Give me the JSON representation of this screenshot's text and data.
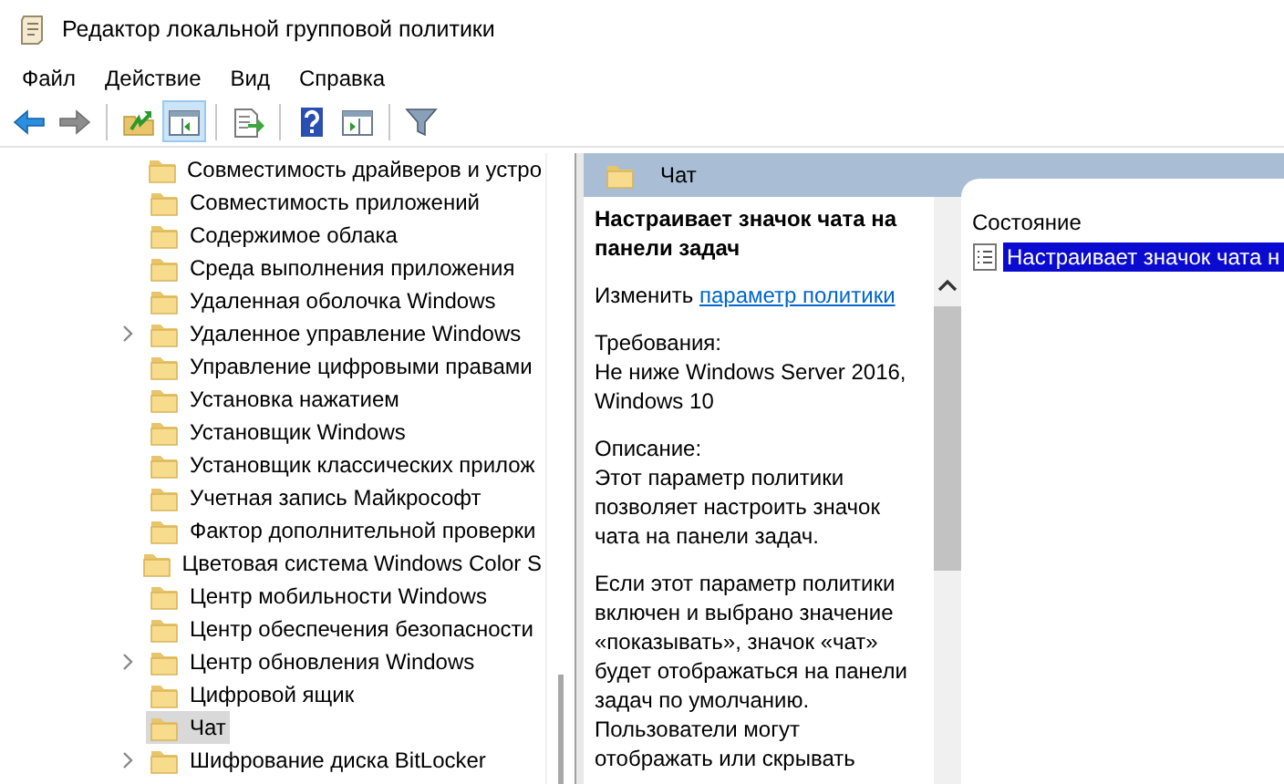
{
  "window": {
    "title": "Редактор локальной групповой политики"
  },
  "menu": [
    "Файл",
    "Действие",
    "Вид",
    "Справка"
  ],
  "toolbar": [
    {
      "kind": "back",
      "pressed": false,
      "disabled": false
    },
    {
      "kind": "forward",
      "pressed": false,
      "disabled": true
    },
    {
      "kind": "separator"
    },
    {
      "kind": "up",
      "pressed": false,
      "disabled": false
    },
    {
      "kind": "tree",
      "pressed": true,
      "disabled": false
    },
    {
      "kind": "separator"
    },
    {
      "kind": "export",
      "pressed": false,
      "disabled": false
    },
    {
      "kind": "separator"
    },
    {
      "kind": "help",
      "pressed": false,
      "disabled": false
    },
    {
      "kind": "view",
      "pressed": false,
      "disabled": false
    },
    {
      "kind": "separator"
    },
    {
      "kind": "filter",
      "pressed": false,
      "disabled": false
    }
  ],
  "tree": {
    "items": [
      {
        "label": "Совместимость драйверов и устро",
        "expandable": false,
        "selected": false
      },
      {
        "label": "Совместимость приложений",
        "expandable": false,
        "selected": false
      },
      {
        "label": "Содержимое облака",
        "expandable": false,
        "selected": false
      },
      {
        "label": "Среда выполнения приложения",
        "expandable": false,
        "selected": false
      },
      {
        "label": "Удаленная оболочка Windows",
        "expandable": false,
        "selected": false
      },
      {
        "label": "Удаленное управление Windows",
        "expandable": true,
        "selected": false
      },
      {
        "label": "Управление цифровыми правами",
        "expandable": false,
        "selected": false
      },
      {
        "label": "Установка нажатием",
        "expandable": false,
        "selected": false
      },
      {
        "label": "Установщик Windows",
        "expandable": false,
        "selected": false
      },
      {
        "label": "Установщик классических прилож",
        "expandable": false,
        "selected": false
      },
      {
        "label": "Учетная запись Майкрософт",
        "expandable": false,
        "selected": false
      },
      {
        "label": "Фактор дополнительной проверки",
        "expandable": false,
        "selected": false
      },
      {
        "label": "Цветовая система Windows Color S",
        "expandable": false,
        "selected": false
      },
      {
        "label": "Центр мобильности Windows",
        "expandable": false,
        "selected": false
      },
      {
        "label": "Центр обеспечения безопасности",
        "expandable": false,
        "selected": false
      },
      {
        "label": "Центр обновления Windows",
        "expandable": true,
        "selected": false
      },
      {
        "label": "Цифровой ящик",
        "expandable": false,
        "selected": false
      },
      {
        "label": "Чат",
        "expandable": false,
        "selected": true
      },
      {
        "label": "Шифрование диска BitLocker",
        "expandable": true,
        "selected": false
      }
    ]
  },
  "details": {
    "header": "Чат",
    "title": "Настраивает значок чата на панели задач",
    "edit_prefix": "Изменить",
    "edit_link": "параметр политики",
    "requirements_label": "Требования:",
    "requirements": "Не ниже Windows Server 2016, Windows 10",
    "description_label": "Описание:",
    "description": [
      "Этот параметр политики позволяет настроить значок чата на панели задач.",
      "Если этот параметр политики включен и выбрано значение «показывать», значок «чат» будет отображаться на панели задач по умолчанию. Пользователи могут отображать или скрывать"
    ]
  },
  "list": {
    "column": "Состояние",
    "rows": [
      {
        "label": "Настраивает значок чата н",
        "selected": true
      }
    ]
  }
}
